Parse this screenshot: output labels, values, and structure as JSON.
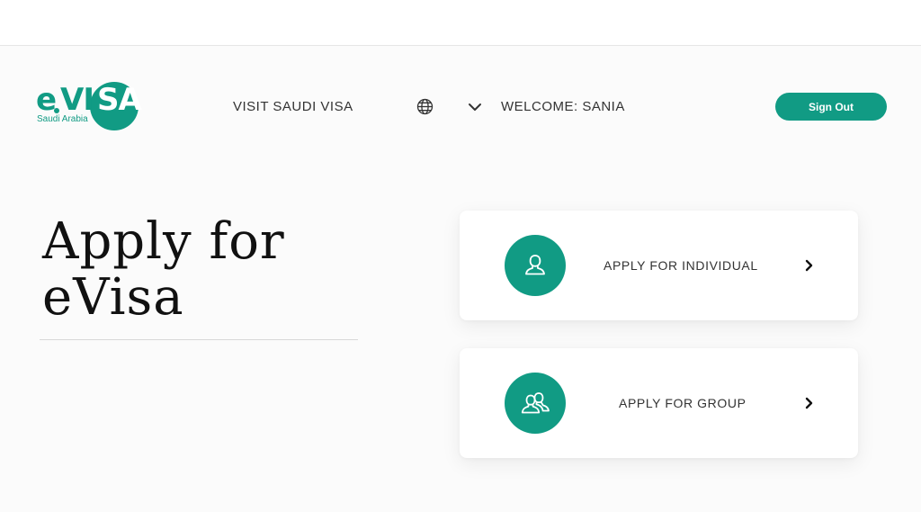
{
  "logo": {
    "e": "e",
    "vi": "VI",
    "sa": "SA",
    "sub": "Saudi Arabia"
  },
  "header": {
    "visit_label": "VISIT SAUDI VISA",
    "language_icon": "globe-icon",
    "dropdown_icon": "chevron-down-icon",
    "welcome_text": "WELCOME: SANIA",
    "signout_label": "Sign Out"
  },
  "main": {
    "title_line1": "Apply for",
    "title_line2": "eVisa"
  },
  "options": [
    {
      "label": "APPLY FOR INDIVIDUAL",
      "icon": "user-icon",
      "arrow": "chevron-right-icon"
    },
    {
      "label": "APPLY FOR GROUP",
      "icon": "users-icon",
      "arrow": "chevron-right-icon"
    }
  ],
  "colors": {
    "brand": "#119b84",
    "background": "#fbfbfb",
    "text": "#333333"
  }
}
